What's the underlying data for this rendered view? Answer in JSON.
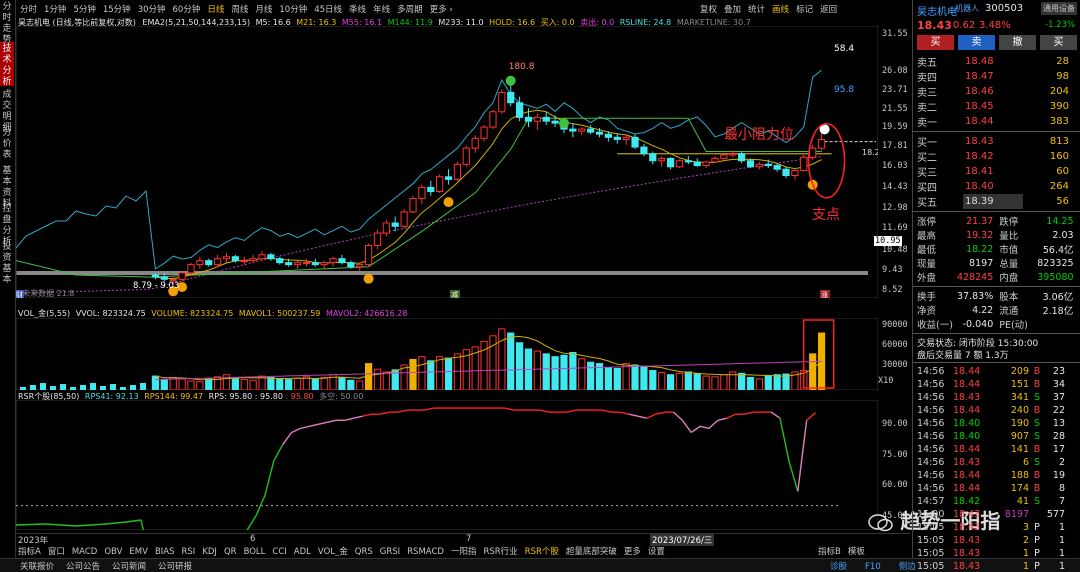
{
  "left_tabs": [
    "分时走势",
    "技术分析",
    "成交明细",
    "分价表",
    "基本资料",
    "控盘分析",
    "投资基本"
  ],
  "periods": [
    "分时",
    "1分钟",
    "5分钟",
    "15分钟",
    "30分钟",
    "60分钟",
    "日线",
    "周线",
    "月线",
    "10分钟",
    "45日线",
    "季线",
    "年线",
    "多周期",
    "更多 ›"
  ],
  "period_selected": "日线",
  "top_right_buttons": [
    "复权",
    "叠加",
    "统计",
    "画线",
    "标记",
    "返回"
  ],
  "top_right_selected": "画线",
  "indicator_line": {
    "name": "昊志机电 (日线,等比前复权,对数)",
    "ema": "EMA2(5,21,50,144,233,15)",
    "m5": "M5: 16.6",
    "m21": "M21: 16.3",
    "m55": "M55: 16.1",
    "m144": "M144: 11.9",
    "m233": "M233: 11.0",
    "hold": "HOLD: 16.6",
    "buy": "买入: 0.0",
    "sell": "卖出: 0.0",
    "rsline": "RSLINE: 24.8",
    "mkt": "MARKETLINE: 30.7"
  },
  "price_axis": [
    "31.55",
    "26.08",
    "23.71",
    "21.55",
    "19.59",
    "17.81",
    "16.03",
    "14.43",
    "12.98",
    "11.69",
    "10.48",
    "9.43",
    "8.52"
  ],
  "price_axis_highlight": "10.95",
  "annotations": {
    "peak_label": "180.8",
    "rs_peak": "58.4",
    "rs_now": "95.8",
    "low_label": "8.79 - 9.03",
    "resistance_text": "最小阻力位",
    "support_text": "支点",
    "right_price": "18.2",
    "future_label": "未来数据 21.8",
    "cai_label": "财",
    "jian_label": "减",
    "zhang_label": "涨"
  },
  "volume_header": {
    "name": "VOL_金(5,55)",
    "vvol": "VVOL: 823324.75",
    "volume": "VOLUME: 823324.75",
    "mavol1": "MAVOL1: 500237.59",
    "mavol2": "MAVOL2: 426616.28"
  },
  "volume_axis": [
    "90000",
    "60000",
    "30000"
  ],
  "volume_unit": "X10",
  "rsr_header": {
    "name": "RSR个股(85,50)",
    "rps41": "RPS41: 92.13",
    "rps144": "RPS144: 99.47",
    "rps": "RPS: 95.80",
    "v1": ": 95.80",
    "v2": ": 95.80",
    "multi": "多空: 50.00"
  },
  "rsr_axis": [
    "90.00",
    "75.00",
    "60.00",
    "45.00"
  ],
  "date_axis": {
    "year": "2023年",
    "m6": "6",
    "m7": "7",
    "cursor": "2023/07/26/三"
  },
  "bottom_tabs": [
    "指标A",
    "窗口",
    "MACD",
    "OBV",
    "EMV",
    "BIAS",
    "RSI",
    "KDJ",
    "QR",
    "BOLL",
    "CCI",
    "ADL",
    "VOL_金",
    "QRS",
    "GRSI",
    "RSMACD",
    "一阳指",
    "RSR行业",
    "RSR个股",
    "超量底部突破",
    "更多",
    "设置"
  ],
  "bottom_selected": "RSR个股",
  "bottom_right_tabs": [
    "指标B",
    "模板"
  ],
  "status_bar": [
    "关联报价",
    "公司公告",
    "公司新闻",
    "公司研报"
  ],
  "status_right": [
    "诊股",
    "F10",
    "侧边"
  ],
  "watermark": "趋势一阳指",
  "quote": {
    "name": "昊志机电",
    "label2": "机器人",
    "code": "300503",
    "device": "通用设备",
    "device_change": "-1.23%",
    "price": "18.43",
    "change": "0.62",
    "pct": "3.48%",
    "buttons": [
      "买",
      "卖",
      "撤",
      "买"
    ],
    "asks": [
      {
        "label": "卖五",
        "price": "18.48",
        "vol": "28"
      },
      {
        "label": "卖四",
        "price": "18.47",
        "vol": "98"
      },
      {
        "label": "卖三",
        "price": "18.46",
        "vol": "204"
      },
      {
        "label": "卖二",
        "price": "18.45",
        "vol": "390"
      },
      {
        "label": "卖一",
        "price": "18.44",
        "vol": "383"
      }
    ],
    "bids": [
      {
        "label": "买一",
        "price": "18.43",
        "vol": "813"
      },
      {
        "label": "买二",
        "price": "18.42",
        "vol": "160"
      },
      {
        "label": "买三",
        "price": "18.41",
        "vol": "60"
      },
      {
        "label": "买四",
        "price": "18.40",
        "vol": "264"
      },
      {
        "label": "买五",
        "price": "18.39",
        "vol": "56"
      }
    ],
    "stats": [
      [
        "涨停",
        "21.37",
        "跌停",
        "14.25"
      ],
      [
        "最高",
        "19.32",
        "量比",
        "2.03"
      ],
      [
        "最低",
        "18.22",
        "市值",
        "56.4亿"
      ],
      [
        "现量",
        "8197",
        "总量",
        "823325"
      ],
      [
        "外盘",
        "428245",
        "内盘",
        "395080"
      ]
    ],
    "stats2": [
      [
        "换手",
        "37.83%",
        "股本",
        "3.06亿"
      ],
      [
        "净资",
        "4.22",
        "流通",
        "2.18亿"
      ],
      [
        "收益(一)",
        "-0.040",
        "PE(动)",
        ""
      ]
    ],
    "trade_status": "交易状态: 闭市阶段 15:30:00",
    "after_hours": "盘后交易量 7 额 1.3万",
    "ticks": [
      [
        "14:56",
        "18.44",
        "209",
        "B",
        "23"
      ],
      [
        "14:56",
        "18.44",
        "151",
        "B",
        "34"
      ],
      [
        "14:56",
        "18.43",
        "341",
        "S",
        "37"
      ],
      [
        "14:56",
        "18.44",
        "240",
        "B",
        "22"
      ],
      [
        "14:56",
        "18.40",
        "190",
        "S",
        "13"
      ],
      [
        "14:56",
        "18.40",
        "907",
        "S",
        "28"
      ],
      [
        "14:56",
        "18.44",
        "141",
        "B",
        "17"
      ],
      [
        "14:56",
        "18.43",
        "6",
        "S",
        "2"
      ],
      [
        "14:56",
        "18.44",
        "188",
        "B",
        "19"
      ],
      [
        "14:56",
        "18.44",
        "174",
        "B",
        "8"
      ],
      [
        "14:57",
        "18.42",
        "41",
        "S",
        "7"
      ],
      [
        "15:00",
        "18.43",
        "8197",
        "",
        "577"
      ],
      [
        "15:05",
        "18.43",
        "3",
        "P",
        "1"
      ],
      [
        "15:05",
        "18.43",
        "2",
        "P",
        "1"
      ],
      [
        "15:05",
        "18.43",
        "1",
        "P",
        "1"
      ],
      [
        "15:05",
        "18.43",
        "1",
        "P",
        "1"
      ]
    ]
  },
  "chart_data": {
    "type": "candlestick",
    "candles": [
      [
        9.2,
        9.3,
        9.0,
        9.1
      ],
      [
        9.1,
        9.3,
        8.9,
        9.0
      ],
      [
        9.0,
        9.1,
        8.8,
        9.0
      ],
      [
        9.0,
        9.4,
        8.9,
        9.3
      ],
      [
        9.3,
        9.8,
        9.2,
        9.7
      ],
      [
        9.7,
        10.1,
        9.5,
        9.9
      ],
      [
        9.9,
        10.0,
        9.6,
        9.7
      ],
      [
        9.7,
        10.2,
        9.6,
        10.0
      ],
      [
        10.0,
        10.3,
        9.8,
        10.1
      ],
      [
        10.1,
        10.2,
        9.8,
        9.9
      ],
      [
        9.9,
        10.1,
        9.7,
        9.9
      ],
      [
        9.9,
        10.2,
        9.8,
        10.0
      ],
      [
        10.0,
        10.4,
        9.9,
        10.2
      ],
      [
        10.2,
        10.3,
        9.9,
        10.0
      ],
      [
        10.0,
        10.1,
        9.7,
        9.8
      ],
      [
        9.8,
        10.0,
        9.6,
        9.7
      ],
      [
        9.7,
        9.9,
        9.5,
        9.8
      ],
      [
        9.8,
        10.0,
        9.6,
        9.8
      ],
      [
        9.8,
        10.0,
        9.6,
        9.7
      ],
      [
        9.7,
        9.9,
        9.5,
        9.8
      ],
      [
        9.8,
        10.1,
        9.6,
        10.0
      ],
      [
        10.0,
        10.2,
        9.7,
        9.8
      ],
      [
        9.8,
        9.9,
        9.5,
        9.6
      ],
      [
        9.6,
        9.8,
        9.4,
        9.7
      ],
      [
        9.7,
        10.8,
        9.6,
        10.7
      ],
      [
        10.7,
        11.6,
        10.5,
        11.4
      ],
      [
        11.4,
        12.2,
        11.2,
        12.0
      ],
      [
        12.0,
        12.4,
        11.5,
        11.8
      ],
      [
        11.8,
        12.9,
        11.7,
        12.7
      ],
      [
        12.7,
        13.8,
        12.6,
        13.6
      ],
      [
        13.6,
        14.6,
        13.2,
        14.4
      ],
      [
        14.4,
        14.9,
        13.8,
        14.1
      ],
      [
        14.1,
        15.4,
        14.0,
        15.2
      ],
      [
        15.2,
        15.8,
        14.6,
        15.0
      ],
      [
        15.0,
        16.4,
        14.9,
        16.2
      ],
      [
        16.2,
        17.8,
        16.0,
        17.6
      ],
      [
        17.6,
        18.8,
        17.2,
        18.5
      ],
      [
        18.5,
        19.8,
        18.2,
        19.6
      ],
      [
        19.6,
        21.4,
        19.4,
        21.2
      ],
      [
        21.2,
        23.8,
        21.0,
        23.4
      ],
      [
        23.4,
        24.5,
        21.8,
        22.2
      ],
      [
        22.2,
        22.9,
        20.2,
        20.6
      ],
      [
        20.6,
        21.6,
        19.6,
        20.2
      ],
      [
        20.2,
        21.0,
        19.3,
        20.6
      ],
      [
        20.6,
        21.2,
        19.8,
        20.2
      ],
      [
        20.2,
        20.8,
        19.6,
        20.0
      ],
      [
        20.0,
        20.4,
        19.0,
        19.4
      ],
      [
        19.4,
        20.0,
        18.6,
        19.2
      ],
      [
        19.2,
        19.6,
        18.8,
        19.4
      ],
      [
        19.4,
        19.8,
        18.9,
        19.1
      ],
      [
        19.1,
        19.5,
        18.6,
        18.9
      ],
      [
        18.9,
        19.2,
        18.2,
        18.6
      ],
      [
        18.6,
        19.0,
        18.0,
        18.4
      ],
      [
        18.4,
        18.9,
        17.9,
        18.6
      ],
      [
        18.6,
        18.9,
        17.5,
        17.7
      ],
      [
        17.7,
        18.0,
        16.9,
        17.1
      ],
      [
        17.1,
        17.3,
        16.2,
        16.5
      ],
      [
        16.5,
        16.9,
        16.0,
        16.7
      ],
      [
        16.7,
        16.8,
        15.8,
        16.0
      ],
      [
        16.0,
        16.6,
        15.9,
        16.5
      ],
      [
        16.5,
        16.9,
        16.2,
        16.4
      ],
      [
        16.4,
        16.7,
        16.0,
        16.1
      ],
      [
        16.1,
        16.5,
        15.9,
        16.4
      ],
      [
        16.4,
        16.9,
        16.3,
        16.7
      ],
      [
        16.7,
        17.2,
        16.5,
        17.0
      ],
      [
        17.0,
        17.4,
        16.8,
        17.1
      ],
      [
        17.1,
        17.3,
        16.3,
        16.5
      ],
      [
        16.5,
        16.7,
        15.9,
        16.0
      ],
      [
        16.0,
        16.4,
        15.8,
        16.2
      ],
      [
        16.2,
        16.6,
        15.9,
        16.1
      ],
      [
        16.1,
        16.3,
        15.6,
        15.8
      ],
      [
        15.8,
        16.0,
        15.1,
        15.3
      ],
      [
        15.3,
        15.9,
        15.0,
        15.7
      ],
      [
        15.7,
        17.0,
        15.6,
        16.8
      ],
      [
        16.8,
        17.9,
        16.6,
        17.6
      ],
      [
        17.6,
        19.3,
        17.4,
        18.4
      ]
    ],
    "volumes": [
      2,
      1.5,
      1.8,
      1.6,
      1.3,
      1.2,
      1.6,
      1.9,
      2.2,
      1.7,
      1.5,
      1.4,
      2.0,
      1.8,
      1.6,
      1.5,
      1.7,
      1.9,
      1.6,
      1.8,
      2.2,
      1.8,
      1.4,
      1.3,
      3.8,
      3.0,
      2.6,
      2.9,
      3.6,
      4.4,
      4.8,
      4.2,
      4.8,
      4.6,
      5.2,
      5.8,
      6.2,
      7.0,
      7.8,
      8.8,
      8.2,
      6.8,
      5.9,
      5.6,
      5.2,
      4.8,
      5.0,
      5.4,
      4.5,
      4.0,
      3.8,
      3.2,
      3.1,
      3.8,
      3.6,
      3.4,
      2.8,
      2.5,
      2.2,
      2.4,
      2.6,
      2.3,
      2.0,
      1.9,
      2.2,
      2.6,
      2.4,
      1.8,
      1.6,
      2.1,
      2.2,
      2.3,
      2.6,
      2.8,
      5.2,
      8.2
    ],
    "rsr": [
      25,
      24,
      23,
      22,
      21,
      20,
      22,
      25,
      30,
      34,
      36,
      38,
      45,
      55,
      72,
      80,
      86,
      88,
      89,
      90,
      91,
      92,
      92,
      93,
      94,
      95,
      95,
      96,
      96,
      97,
      97,
      97,
      98,
      98,
      98,
      98,
      98,
      98,
      98,
      98,
      98,
      97,
      97,
      97,
      97,
      96,
      96,
      96,
      97,
      97,
      97,
      97,
      96,
      96,
      95,
      94,
      93,
      95,
      96,
      96,
      92,
      86,
      89,
      88,
      92,
      93,
      95,
      95,
      96,
      96,
      96,
      93,
      72,
      57,
      92,
      95.8
    ],
    "ylim": [
      8.52,
      31.55
    ],
    "volume_ylim": [
      0,
      90000
    ],
    "rsr_ylim": [
      40,
      100
    ]
  },
  "colors": {
    "up": "#ff3030",
    "down": "#40e8f0",
    "bg": "#000000",
    "accent": "#ff3030",
    "highlight": "#f0b000"
  }
}
